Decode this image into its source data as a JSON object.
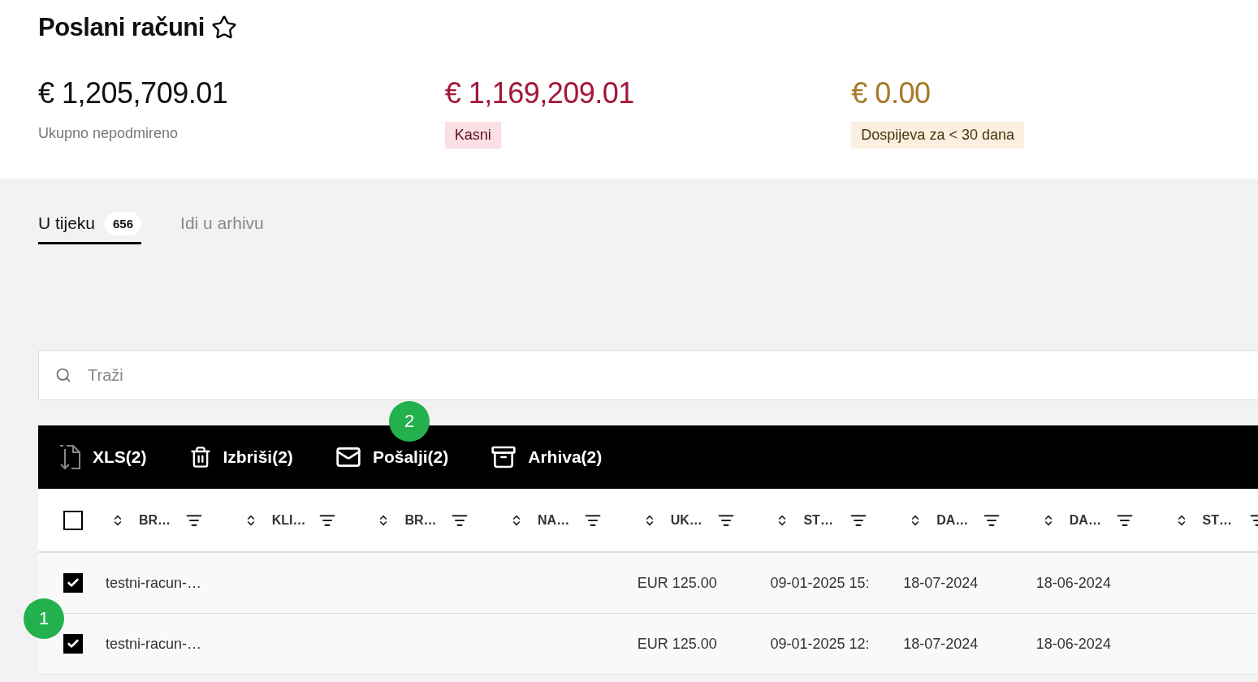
{
  "page": {
    "title": "Poslani računi",
    "favorite": false
  },
  "stats": [
    {
      "amount": "€ 1,205,709.01",
      "label": "Ukupno nepodmireno",
      "kind": "plain"
    },
    {
      "amount": "€ 1,169,209.01",
      "label": "Kasni",
      "kind": "overdue"
    },
    {
      "amount": "€ 0.00",
      "label": "Dospijeva za < 30 dana",
      "kind": "due-soon"
    }
  ],
  "tabs": [
    {
      "label": "U tijeku",
      "count": "656",
      "selected": true
    },
    {
      "label": "Idi u arhivu",
      "selected": false
    }
  ],
  "search": {
    "placeholder": "Traži"
  },
  "toolbar": [
    {
      "label": "XLS(2)",
      "kind": "export"
    },
    {
      "label": "Izbriši(2)",
      "kind": "delete"
    },
    {
      "label": "Pošalji(2)",
      "kind": "send"
    },
    {
      "label": "Arhiva(2)",
      "kind": "archive"
    }
  ],
  "table": {
    "select_all": false,
    "columns": [
      "BR…",
      "KLI…",
      "BR…",
      "NA…",
      "UK…",
      "ST…",
      "DA…",
      "DA…",
      "ST…"
    ],
    "rows": [
      {
        "checked": true,
        "column_1": "testni-racun-…",
        "column_5": "EUR 125.00",
        "column_6": "09-01-2025 15:",
        "column_7": "18-07-2024",
        "column_8": "18-06-2024"
      },
      {
        "checked": true,
        "column_1": "testni-racun-…",
        "column_5": "EUR 125.00",
        "column_6": "09-01-2025 12:",
        "column_7": "18-07-2024",
        "column_8": "18-06-2024"
      }
    ]
  },
  "markers": [
    {
      "label": "1"
    },
    {
      "label": "2"
    }
  ]
}
